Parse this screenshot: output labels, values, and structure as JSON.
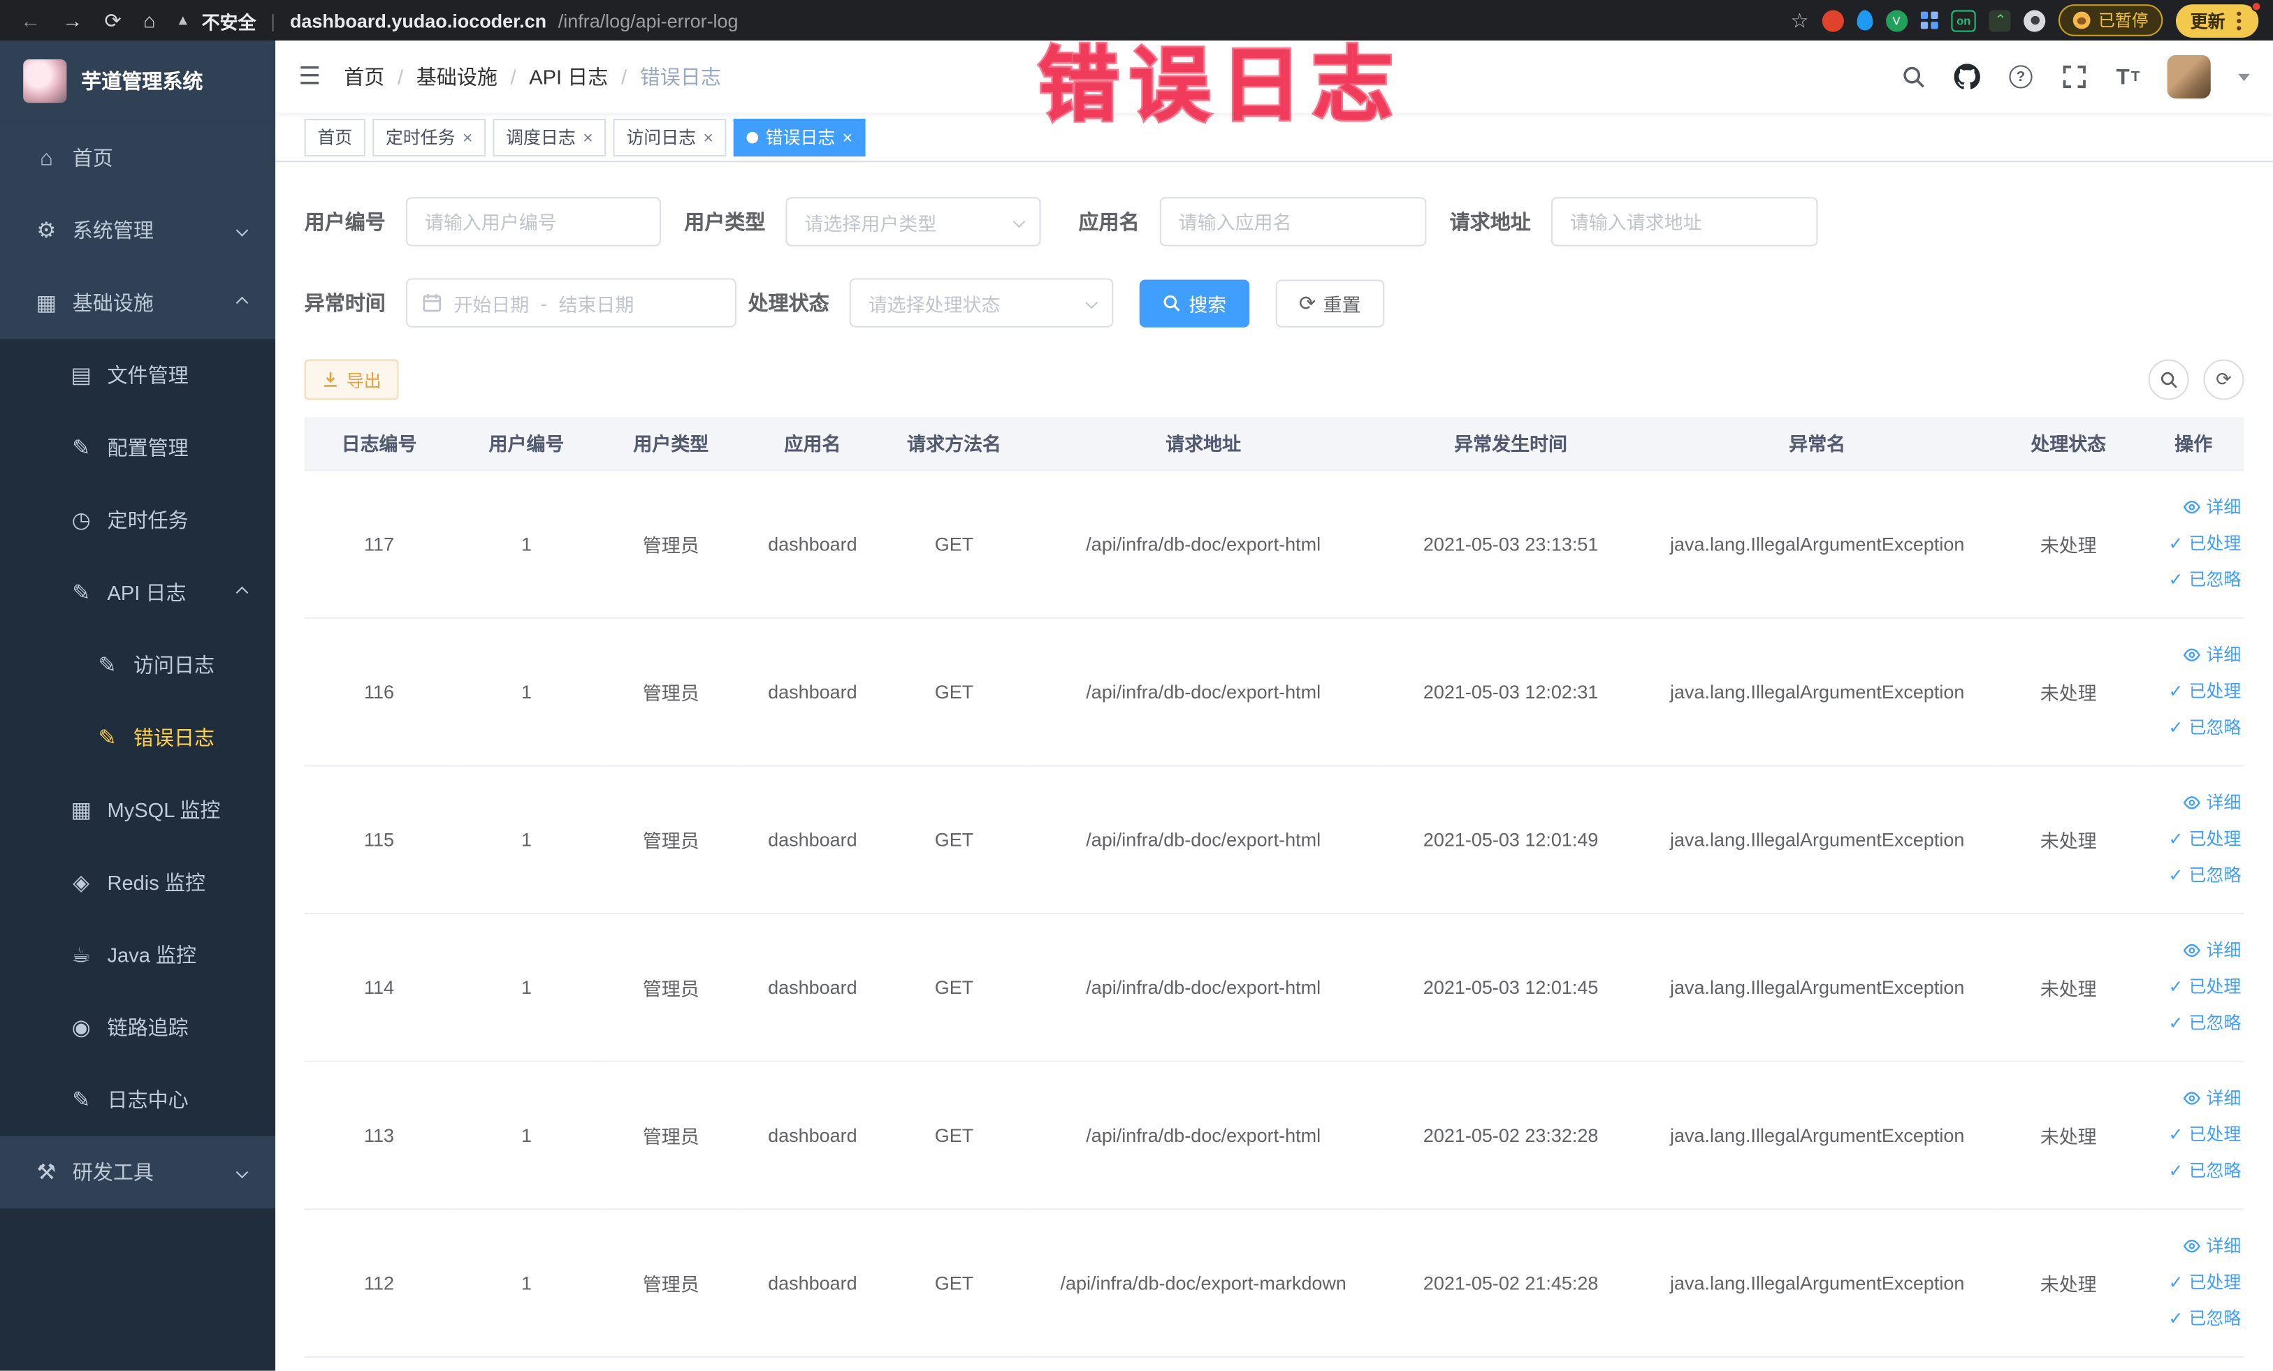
{
  "icons": {
    "back": "←",
    "forward": "→",
    "reload": "⟳",
    "home": "⌂",
    "warning": "▲",
    "star": "☆",
    "divider": "|",
    "hamburger": "☰",
    "breadcrumb_sep": "/",
    "help": "?",
    "fontsize_big": "T",
    "fontsize_small": "T",
    "close": "×",
    "check": "✓",
    "refresh": "⟳",
    "ext_v": "V"
  },
  "browser": {
    "security": "不安全",
    "url_host": "dashboard.yudao.iocoder.cn",
    "url_path": "/infra/log/api-error-log",
    "ext_on": "on",
    "paused": "已暂停",
    "update": "更新"
  },
  "annotation": {
    "text": "错误日志"
  },
  "colors": {
    "accent": "#409eff",
    "sidebar": "#304156",
    "sidebar_sub": "#1f2d3d",
    "active_menu": "#ffd04b",
    "warning": "#e6a23c",
    "annotation": "#f34864"
  },
  "sidebar": {
    "title": "芋道管理系统",
    "items": [
      {
        "label": "首页",
        "icon": "⌂"
      },
      {
        "label": "系统管理",
        "icon": "⚙"
      },
      {
        "label": "基础设施",
        "icon": "▦"
      },
      {
        "label": "文件管理",
        "icon": "▤"
      },
      {
        "label": "配置管理",
        "icon": "✎"
      },
      {
        "label": "定时任务",
        "icon": "◷"
      },
      {
        "label": "API 日志",
        "icon": "✎"
      },
      {
        "label": "访问日志",
        "icon": "✎"
      },
      {
        "label": "错误日志",
        "icon": "✎"
      },
      {
        "label": "MySQL 监控",
        "icon": "▦"
      },
      {
        "label": "Redis 监控",
        "icon": "◈"
      },
      {
        "label": "Java 监控",
        "icon": "☕"
      },
      {
        "label": "链路追踪",
        "icon": "◉"
      },
      {
        "label": "日志中心",
        "icon": "✎"
      },
      {
        "label": "研发工具",
        "icon": "⚒"
      }
    ]
  },
  "header": {
    "breadcrumb": [
      "首页",
      "基础设施",
      "API 日志",
      "错误日志"
    ]
  },
  "tabs": [
    {
      "label": "首页"
    },
    {
      "label": "定时任务"
    },
    {
      "label": "调度日志"
    },
    {
      "label": "访问日志"
    },
    {
      "label": "错误日志"
    }
  ],
  "filters": {
    "user_no": {
      "label": "用户编号",
      "placeholder": "请输入用户编号"
    },
    "user_type": {
      "label": "用户类型",
      "placeholder": "请选择用户类型"
    },
    "app_name": {
      "label": "应用名",
      "placeholder": "请输入应用名"
    },
    "request_url": {
      "label": "请求地址",
      "placeholder": "请输入请求地址"
    },
    "exception_time": {
      "label": "异常时间",
      "start": "开始日期",
      "separator": "-",
      "end": "结束日期"
    },
    "process_status": {
      "label": "处理状态",
      "placeholder": "请选择处理状态"
    },
    "search": "搜索",
    "reset": "重置"
  },
  "toolbar": {
    "export": "导出"
  },
  "table": {
    "columns": [
      "日志编号",
      "用户编号",
      "用户类型",
      "应用名",
      "请求方法名",
      "请求地址",
      "异常发生时间",
      "异常名",
      "处理状态",
      "操作"
    ],
    "actions": [
      "详细",
      "已处理",
      "已忽略"
    ],
    "rows": [
      {
        "id": "117",
        "uid": "1",
        "utype": "管理员",
        "app": "dashboard",
        "method": "GET",
        "url": "/api/infra/db-doc/export-html",
        "time": "2021-05-03 23:13:51",
        "exc": "java.lang.IllegalArgumentException",
        "status": "未处理"
      },
      {
        "id": "116",
        "uid": "1",
        "utype": "管理员",
        "app": "dashboard",
        "method": "GET",
        "url": "/api/infra/db-doc/export-html",
        "time": "2021-05-03 12:02:31",
        "exc": "java.lang.IllegalArgumentException",
        "status": "未处理"
      },
      {
        "id": "115",
        "uid": "1",
        "utype": "管理员",
        "app": "dashboard",
        "method": "GET",
        "url": "/api/infra/db-doc/export-html",
        "time": "2021-05-03 12:01:49",
        "exc": "java.lang.IllegalArgumentException",
        "status": "未处理"
      },
      {
        "id": "114",
        "uid": "1",
        "utype": "管理员",
        "app": "dashboard",
        "method": "GET",
        "url": "/api/infra/db-doc/export-html",
        "time": "2021-05-03 12:01:45",
        "exc": "java.lang.IllegalArgumentException",
        "status": "未处理"
      },
      {
        "id": "113",
        "uid": "1",
        "utype": "管理员",
        "app": "dashboard",
        "method": "GET",
        "url": "/api/infra/db-doc/export-html",
        "time": "2021-05-02 23:32:28",
        "exc": "java.lang.IllegalArgumentException",
        "status": "未处理"
      },
      {
        "id": "112",
        "uid": "1",
        "utype": "管理员",
        "app": "dashboard",
        "method": "GET",
        "url": "/api/infra/db-doc/export-markdown",
        "time": "2021-05-02 21:45:28",
        "exc": "java.lang.IllegalArgumentException",
        "status": "未处理"
      }
    ]
  }
}
